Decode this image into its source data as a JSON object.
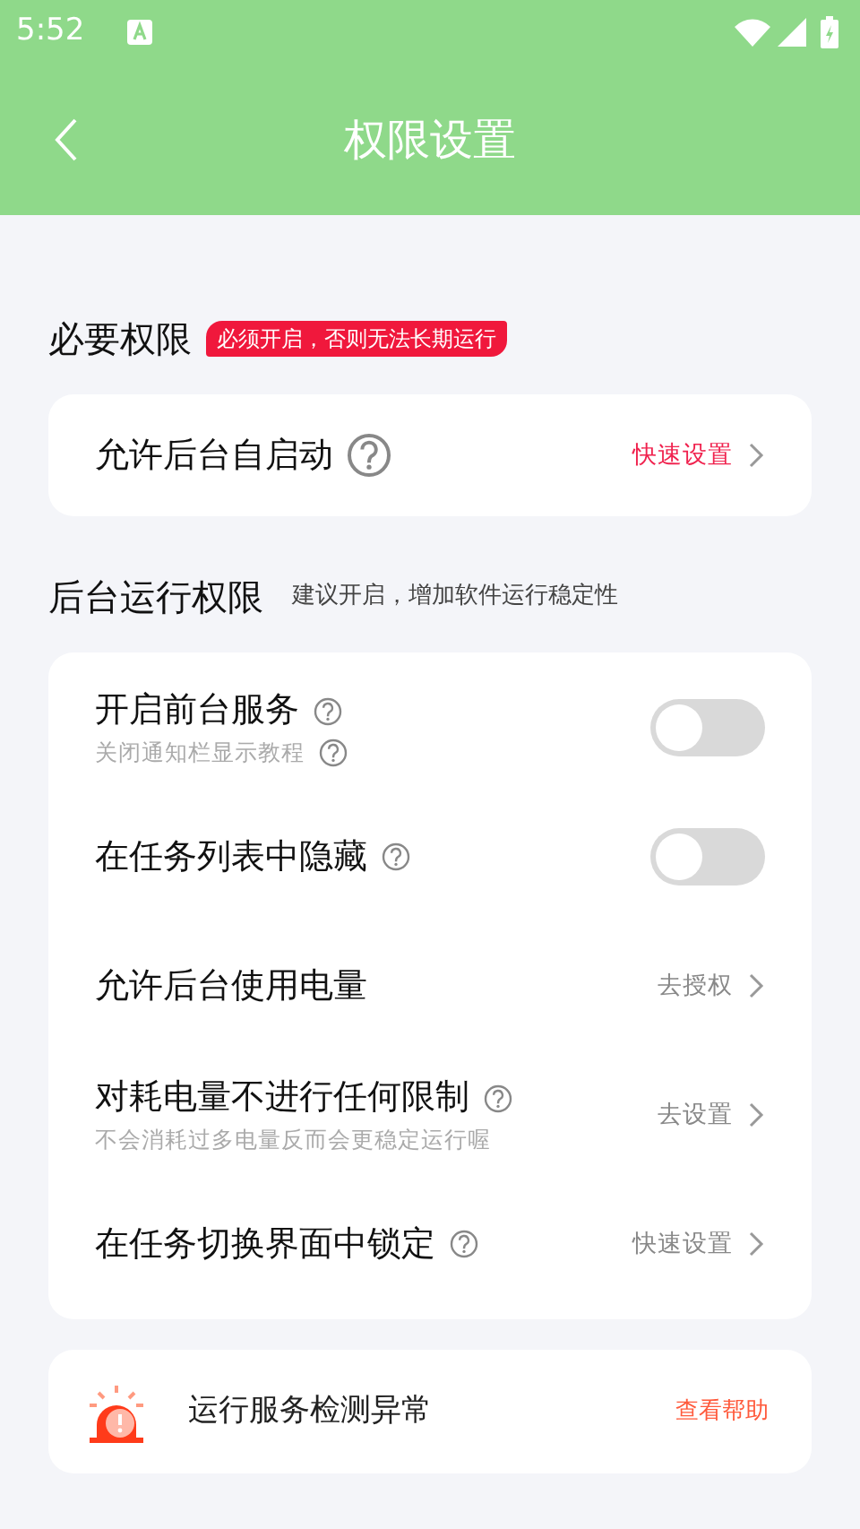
{
  "status_bar": {
    "time": "5:52"
  },
  "app_bar": {
    "title": "权限设置"
  },
  "sections": [
    {
      "title": "必要权限",
      "badge": "必须开启，否则无法长期运行",
      "rows": [
        {
          "kind": "link",
          "label": "允许后台自启动",
          "help_icon": true,
          "action": "快速设置",
          "color": "#f0224e"
        }
      ]
    },
    {
      "title": "后台运行权限",
      "note": "建议开启，增加软件运行稳定性",
      "rows": [
        {
          "kind": "toggle",
          "label": "开启前台服务",
          "help_icon": true,
          "subtitle": "关闭通知栏显示教程",
          "subtitle_help": true,
          "on": false
        },
        {
          "kind": "toggle",
          "label": "在任务列表中隐藏",
          "help_icon": true,
          "on": false
        },
        {
          "kind": "link",
          "label": "允许后台使用电量",
          "help_icon": false,
          "action": "去授权",
          "color": "#888888"
        },
        {
          "kind": "link",
          "label": "对耗电量不进行任何限制",
          "help_icon": true,
          "subtitle": "不会消耗过多电量反而会更稳定运行喔",
          "action": "去设置",
          "color": "#888888"
        },
        {
          "kind": "link",
          "label": "在任务切换界面中锁定",
          "help_icon": true,
          "action": "快速设置",
          "color": "#888888"
        }
      ]
    }
  ],
  "alert": {
    "text": "运行服务检测异常",
    "action": "查看帮助"
  }
}
